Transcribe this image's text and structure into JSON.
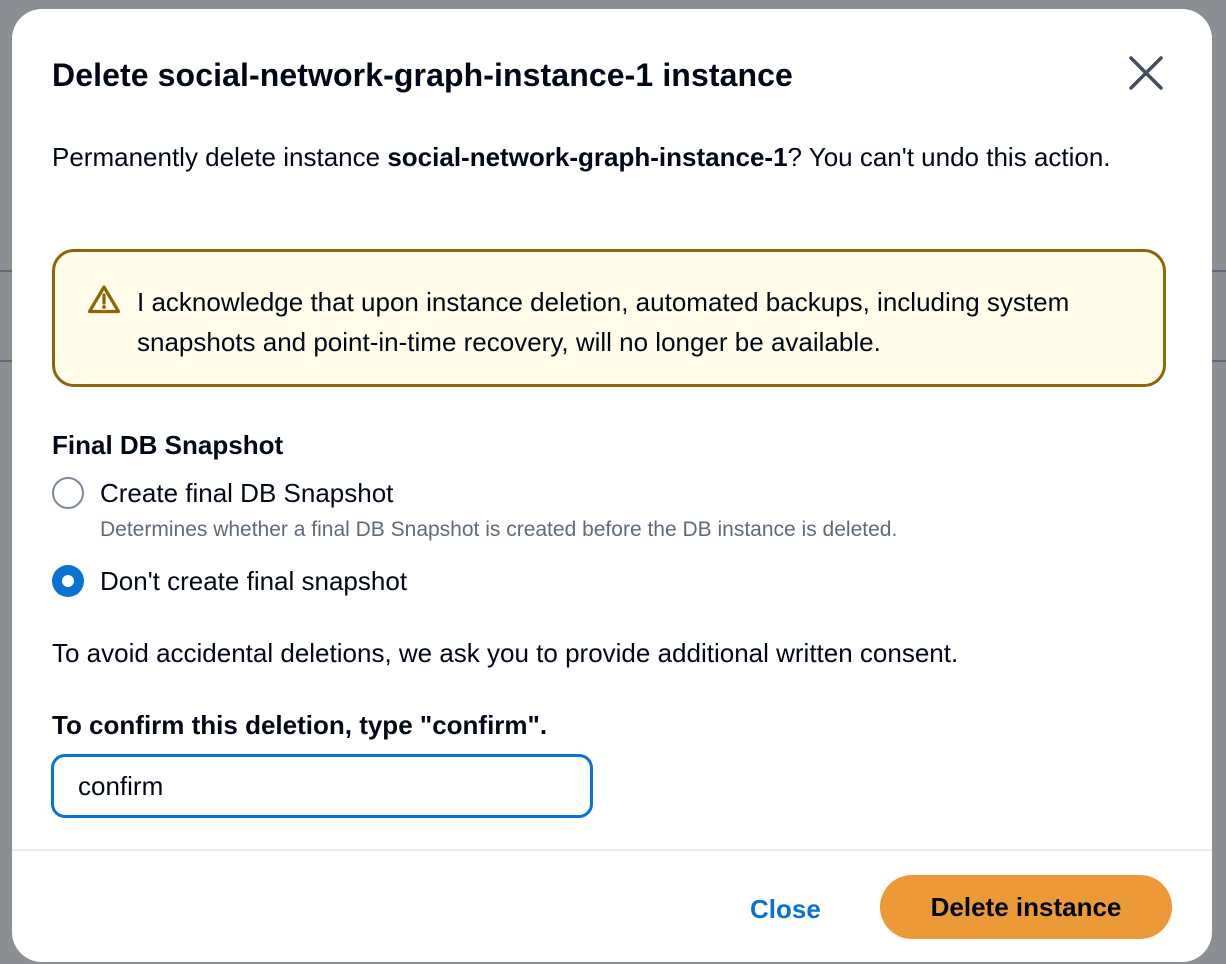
{
  "dialog": {
    "title_prefix": "Delete",
    "title_name": "social-network-graph-instance-1",
    "title_suffix": "instance",
    "close_icon": "close-icon",
    "description_prefix": "Permanently delete instance",
    "description_name": "social-network-graph-instance-1",
    "description_suffix": "? You can't undo this action.",
    "alert": {
      "icon": "warning-icon",
      "text": "I acknowledge that upon instance deletion, automated backups, including system snapshots and point-in-time recovery, will no longer be available."
    },
    "snapshot": {
      "label": "Final DB Snapshot",
      "options": [
        {
          "label": "Create final DB Snapshot",
          "description": "Determines whether a final DB Snapshot is created before the DB instance is deleted.",
          "selected": false
        },
        {
          "label": "Don't create final snapshot",
          "selected": true
        }
      ]
    },
    "consent_text": "To avoid accidental deletions, we ask you to provide additional written consent.",
    "confirm_label": "To confirm this deletion, type \"confirm\".",
    "confirm_value": "confirm",
    "buttons": {
      "close": "Close",
      "delete": "Delete instance"
    }
  },
  "colors": {
    "primary_blue": "#0972d3",
    "delete_orange": "#ec9937",
    "warning_border": "#8d6605",
    "warning_bg": "#fffce9"
  }
}
